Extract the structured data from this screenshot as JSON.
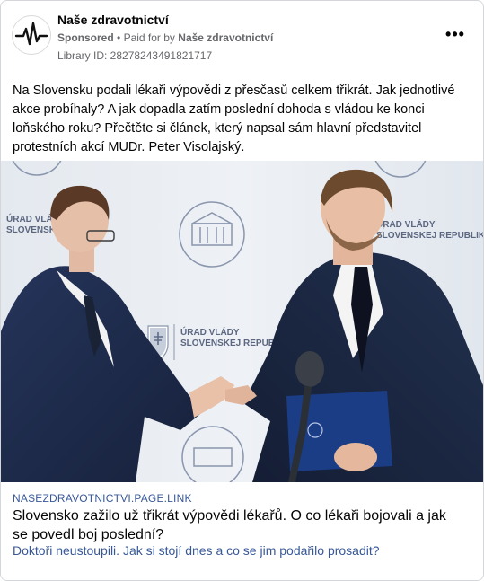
{
  "advertiser": {
    "name": "Naše zdravotnictví",
    "sponsored_label": "Sponsored",
    "paid_for_prefix": "Paid for by",
    "paid_for_name": "Naše zdravotnictví",
    "library_id": "Library ID: 28278243491821717",
    "logo_icon": "heartbeat-line-icon"
  },
  "menu": {
    "more_label": "•••"
  },
  "post": {
    "text": "Na Slovensku podali lékaři výpovědi z přesčasů celkem třikrát. Jak jednotlivé akce probíhaly? A jak dopadla zatím poslední dohoda s vládou ke konci loňského roku? Přečtěte si článek, který napsal sám hlavní představitel protestních akcí MUDr. Peter Visolajský."
  },
  "photo": {
    "backdrop_text_left": [
      "ÚRAD VLÁDY",
      "SLOVENSKEJ"
    ],
    "backdrop_text_center": [
      "ÚRAD VLÁDY",
      "SLOVENSKEJ REPUBLIKY"
    ],
    "backdrop_text_right": [
      "ÚRAD VLÁDY",
      "SLOVENSKEJ REPUBLIKY"
    ]
  },
  "link": {
    "domain": "NASEZDRAVOTNICTVI.PAGE.LINK",
    "headline": "Slovensko zažilo už třikrát výpovědi lékařů. O co lékaři bojovali a jak se povedl boj poslední?",
    "description": "Doktoři neustoupili. Jak si stojí dnes a co se jim podařilo prosadit?"
  },
  "colors": {
    "link_blue": "#385898",
    "secondary_text": "#65676b",
    "backdrop": "#e9edf2",
    "suit_navy": "#1e2b4a"
  }
}
